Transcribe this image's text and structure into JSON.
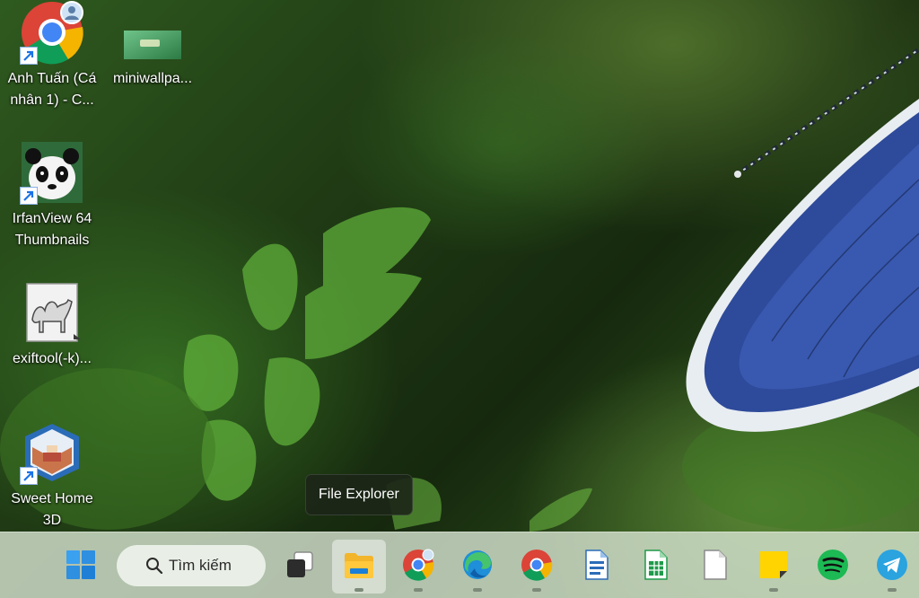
{
  "desktop": {
    "icons": [
      {
        "label": "Anh Tuấn (Cá nhân 1) - C...",
        "icon": "chrome-profile-icon"
      },
      {
        "label": "miniwallpa...",
        "icon": "image-thumbnail-icon"
      },
      {
        "label": "IrfanView 64 Thumbnails",
        "icon": "panda-icon"
      },
      {
        "label": "exiftool(-k)...",
        "icon": "camel-icon"
      },
      {
        "label": "Sweet Home 3D",
        "icon": "house-3d-icon"
      }
    ],
    "tooltip": "File Explorer"
  },
  "taskbar": {
    "search_placeholder": "Tìm kiếm",
    "apps": [
      {
        "name": "Start",
        "icon": "windows-start-icon"
      },
      {
        "name": "Task View",
        "icon": "task-view-icon"
      },
      {
        "name": "File Explorer",
        "icon": "folder-icon",
        "active": true
      },
      {
        "name": "Chrome (profile)",
        "icon": "chrome-profile-icon",
        "running": true
      },
      {
        "name": "Microsoft Edge",
        "icon": "edge-icon",
        "running": true
      },
      {
        "name": "Google Chrome",
        "icon": "chrome-icon",
        "running": true
      },
      {
        "name": "Document",
        "icon": "doc-icon"
      },
      {
        "name": "Spreadsheet",
        "icon": "spreadsheet-icon"
      },
      {
        "name": "Blank File",
        "icon": "blank-file-icon"
      },
      {
        "name": "Sticky Notes",
        "icon": "sticky-notes-icon",
        "running": true
      },
      {
        "name": "Spotify",
        "icon": "spotify-icon"
      },
      {
        "name": "Telegram",
        "icon": "telegram-icon",
        "running": true
      }
    ]
  },
  "colors": {
    "taskbar_bg": "#d4e2ce",
    "tooltip_bg": "#1c2618",
    "windows_blue": "#3aa0f0",
    "butterfly_blue": "#2e4a9a"
  }
}
